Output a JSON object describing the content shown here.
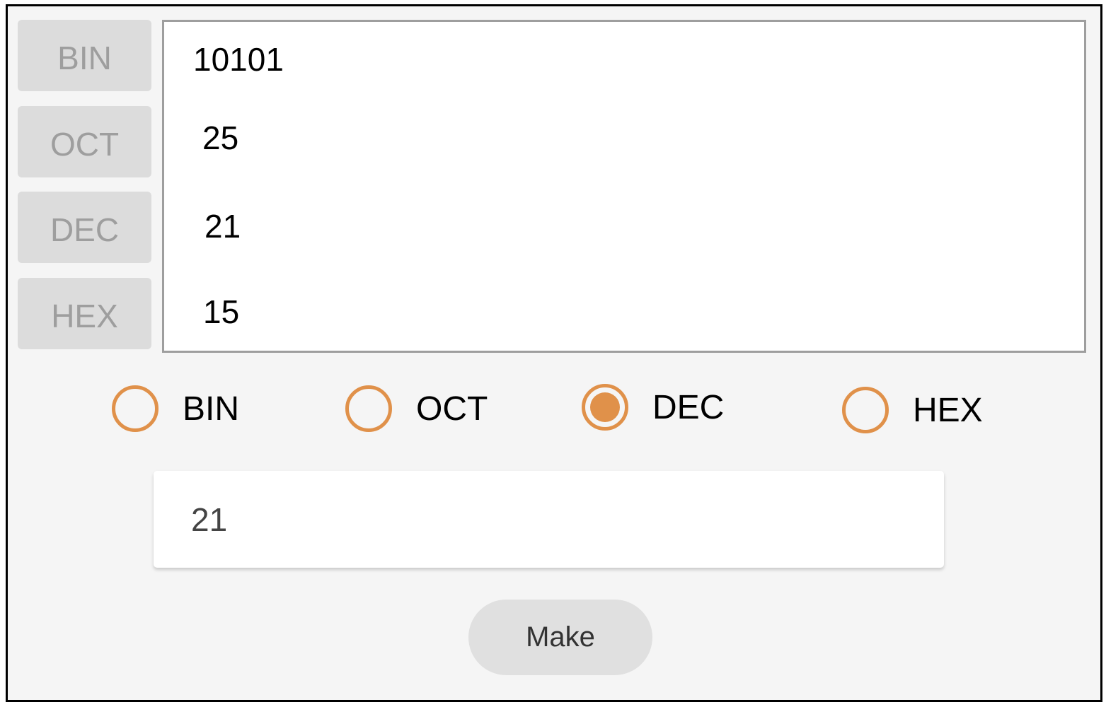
{
  "labels": {
    "bin": "BIN",
    "oct": "OCT",
    "dec": "DEC",
    "hex": "HEX"
  },
  "results": {
    "bin": "10101",
    "oct": "25",
    "dec": "21",
    "hex": "15"
  },
  "radios": [
    {
      "label": "BIN",
      "selected": false
    },
    {
      "label": "OCT",
      "selected": false
    },
    {
      "label": "DEC",
      "selected": true
    },
    {
      "label": "HEX",
      "selected": false
    }
  ],
  "input": {
    "value": "21"
  },
  "make_button": {
    "label": "Make"
  },
  "colors": {
    "accent": "#e0914a",
    "label_button_bg": "#dcdcdc",
    "label_button_text": "#9e9e9e",
    "panel_bg": "#f5f5f5"
  }
}
